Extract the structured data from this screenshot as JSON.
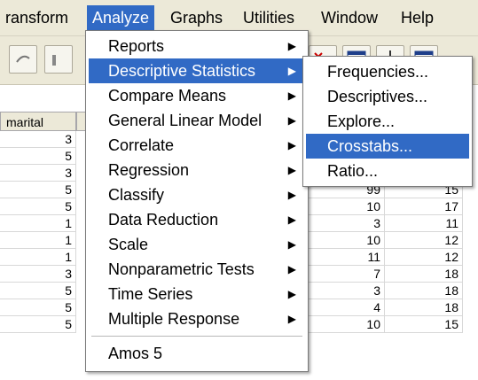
{
  "menubar": {
    "items": [
      "ransform",
      "Analyze",
      "Graphs",
      "Utilities",
      "Window",
      "Help"
    ]
  },
  "grid": {
    "column_header": "marital",
    "left_values": [
      "3",
      "5",
      "3",
      "5",
      "5",
      "1",
      "1",
      "1",
      "3",
      "5",
      "5",
      "5"
    ],
    "right_values": [
      {
        "a": "99",
        "b": "15"
      },
      {
        "a": "10",
        "b": "17"
      },
      {
        "a": "3",
        "b": "11"
      },
      {
        "a": "10",
        "b": "12"
      },
      {
        "a": "11",
        "b": "12"
      },
      {
        "a": "7",
        "b": "18"
      },
      {
        "a": "3",
        "b": "18"
      },
      {
        "a": "4",
        "b": "18"
      },
      {
        "a": "10",
        "b": "15"
      }
    ]
  },
  "analyze_menu": {
    "items": [
      {
        "label": "Reports",
        "submenu": true
      },
      {
        "label": "Descriptive Statistics",
        "submenu": true
      },
      {
        "label": "Compare Means",
        "submenu": true
      },
      {
        "label": "General Linear Model",
        "submenu": true
      },
      {
        "label": "Correlate",
        "submenu": true
      },
      {
        "label": "Regression",
        "submenu": true
      },
      {
        "label": "Classify",
        "submenu": true
      },
      {
        "label": "Data Reduction",
        "submenu": true
      },
      {
        "label": "Scale",
        "submenu": true
      },
      {
        "label": "Nonparametric Tests",
        "submenu": true
      },
      {
        "label": "Time Series",
        "submenu": true
      },
      {
        "label": "Multiple Response",
        "submenu": true
      },
      {
        "label": "Amos 5",
        "submenu": false
      }
    ]
  },
  "descriptive_submenu": {
    "items": [
      "Frequencies...",
      "Descriptives...",
      "Explore...",
      "Crosstabs...",
      "Ratio..."
    ]
  },
  "colors": {
    "highlight": "#316ac5",
    "menubar": "#ece9d8"
  }
}
